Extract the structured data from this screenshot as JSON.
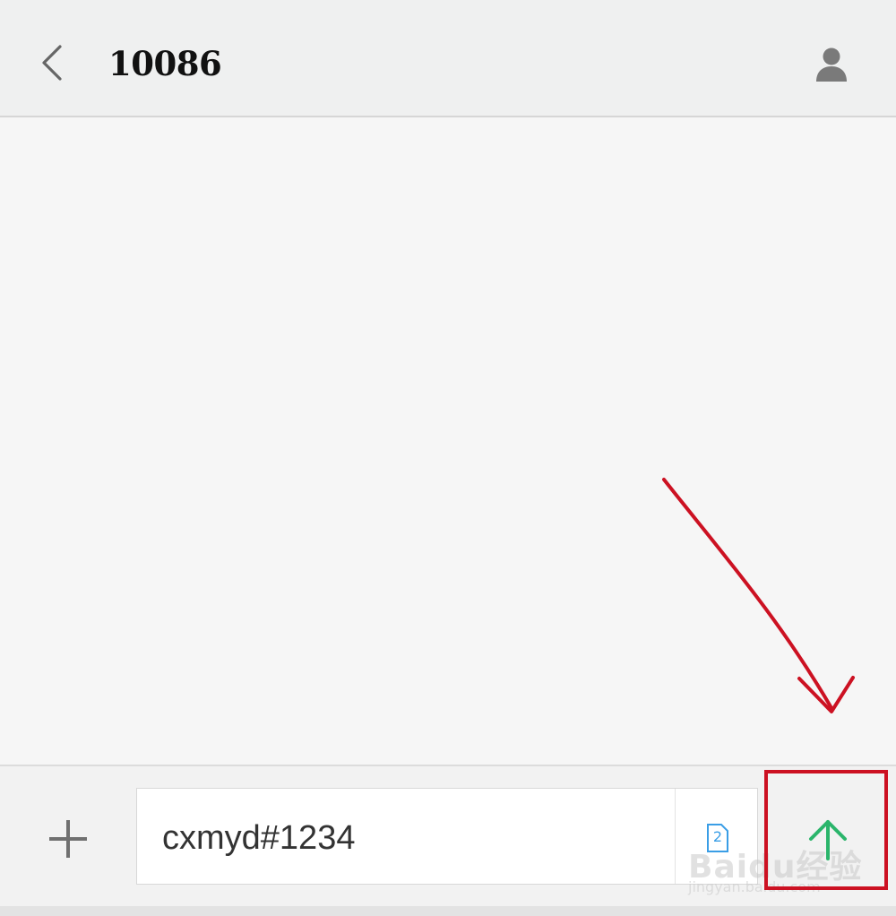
{
  "header": {
    "title": "10086"
  },
  "composer": {
    "input_value": "cxmyd#1234",
    "sim_slot": "2"
  },
  "watermark": {
    "brand": "Baidu经验",
    "url": "jingyan.baidu.com"
  },
  "colors": {
    "send_arrow": "#2bb56b",
    "annotation": "#cc1122",
    "sim_icon": "#3a9ee6"
  }
}
